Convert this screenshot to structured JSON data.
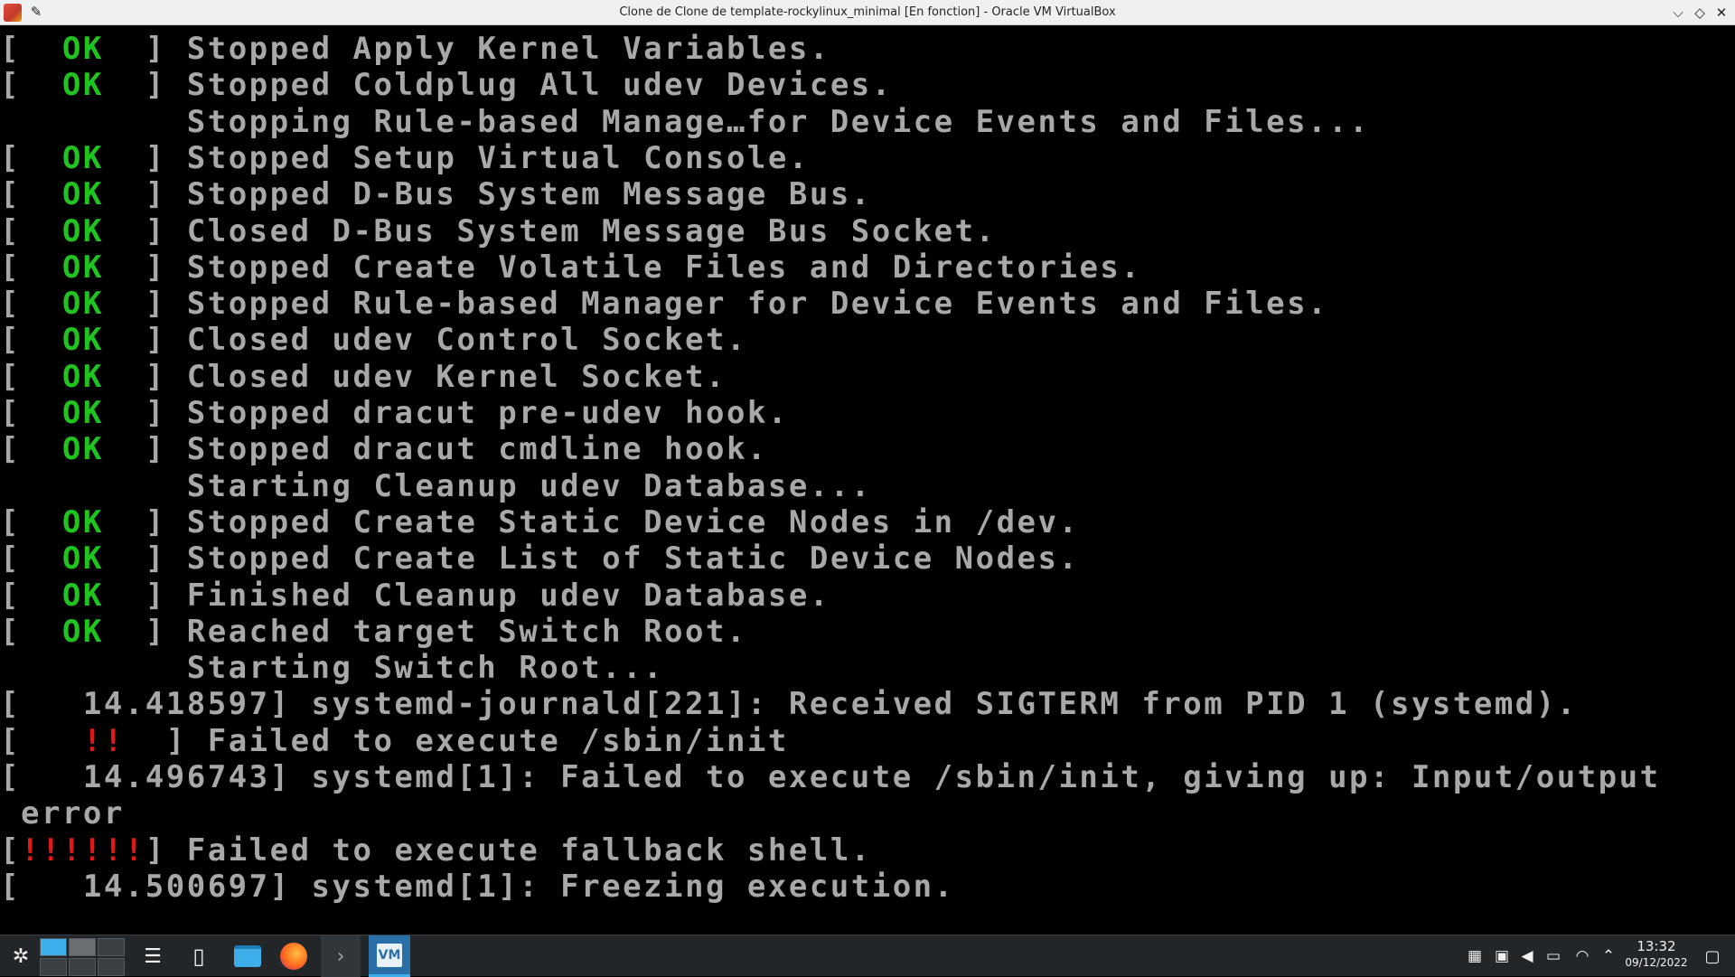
{
  "window": {
    "title": "Clone de Clone de template-rockylinux_minimal [En fonction] - Oracle VM VirtualBox",
    "pin_icon": "pin-icon",
    "min_label": "⌵",
    "max_label": "◇",
    "close_label": "✕"
  },
  "console": {
    "lines": [
      {
        "pre": "[  ",
        "status": "OK",
        "status_type": "ok",
        "post": "  ] Stopped Apply Kernel Variables."
      },
      {
        "pre": "[  ",
        "status": "OK",
        "status_type": "ok",
        "post": "  ] Stopped Coldplug All udev Devices."
      },
      {
        "pre": "",
        "status": "",
        "status_type": "none",
        "post": "         Stopping Rule-based Manage…for Device Events and Files..."
      },
      {
        "pre": "[  ",
        "status": "OK",
        "status_type": "ok",
        "post": "  ] Stopped Setup Virtual Console."
      },
      {
        "pre": "[  ",
        "status": "OK",
        "status_type": "ok",
        "post": "  ] Stopped D-Bus System Message Bus."
      },
      {
        "pre": "[  ",
        "status": "OK",
        "status_type": "ok",
        "post": "  ] Closed D-Bus System Message Bus Socket."
      },
      {
        "pre": "[  ",
        "status": "OK",
        "status_type": "ok",
        "post": "  ] Stopped Create Volatile Files and Directories."
      },
      {
        "pre": "[  ",
        "status": "OK",
        "status_type": "ok",
        "post": "  ] Stopped Rule-based Manager for Device Events and Files."
      },
      {
        "pre": "[  ",
        "status": "OK",
        "status_type": "ok",
        "post": "  ] Closed udev Control Socket."
      },
      {
        "pre": "[  ",
        "status": "OK",
        "status_type": "ok",
        "post": "  ] Closed udev Kernel Socket."
      },
      {
        "pre": "[  ",
        "status": "OK",
        "status_type": "ok",
        "post": "  ] Stopped dracut pre-udev hook."
      },
      {
        "pre": "[  ",
        "status": "OK",
        "status_type": "ok",
        "post": "  ] Stopped dracut cmdline hook."
      },
      {
        "pre": "",
        "status": "",
        "status_type": "none",
        "post": "         Starting Cleanup udev Database..."
      },
      {
        "pre": "[  ",
        "status": "OK",
        "status_type": "ok",
        "post": "  ] Stopped Create Static Device Nodes in /dev."
      },
      {
        "pre": "[  ",
        "status": "OK",
        "status_type": "ok",
        "post": "  ] Stopped Create List of Static Device Nodes."
      },
      {
        "pre": "[  ",
        "status": "OK",
        "status_type": "ok",
        "post": "  ] Finished Cleanup udev Database."
      },
      {
        "pre": "[  ",
        "status": "OK",
        "status_type": "ok",
        "post": "  ] Reached target Switch Root."
      },
      {
        "pre": "",
        "status": "",
        "status_type": "none",
        "post": "         Starting Switch Root..."
      },
      {
        "pre": "[   14.418597] systemd-journald[221]: Received SIGTERM from PID 1 (systemd).",
        "status": "",
        "status_type": "none",
        "post": ""
      },
      {
        "pre": "[   ",
        "status": "!!",
        "status_type": "fail",
        "post": "  ] Failed to execute /sbin/init"
      },
      {
        "pre": "[   14.496743] systemd[1]: Failed to execute /sbin/init, giving up: Input/output",
        "status": "",
        "status_type": "none",
        "post": ""
      },
      {
        "pre": " error",
        "status": "",
        "status_type": "none",
        "post": ""
      },
      {
        "pre": "[",
        "status": "!!!!!!",
        "status_type": "fail",
        "post": "] Failed to execute fallback shell."
      },
      {
        "pre": "[   14.500697] systemd[1]: Freezing execution.",
        "status": "",
        "status_type": "none",
        "post": ""
      }
    ]
  },
  "taskbar": {
    "launcher_icon": "application-launcher-icon",
    "pager": {
      "desktops": 6,
      "active": 1
    },
    "apps": [
      {
        "name": "settings-icon"
      },
      {
        "name": "text-editor-icon"
      },
      {
        "name": "file-manager-icon"
      },
      {
        "name": "firefox-icon"
      },
      {
        "name": "konsole-icon"
      },
      {
        "name": "virtualbox-icon",
        "label": "VM"
      }
    ],
    "tray": [
      "clipboard-icon",
      "notes-icon",
      "volume-icon",
      "battery-icon",
      "wifi-icon",
      "tray-expand-icon"
    ],
    "clock": {
      "time": "13:32",
      "date": "09/12/2022"
    }
  }
}
